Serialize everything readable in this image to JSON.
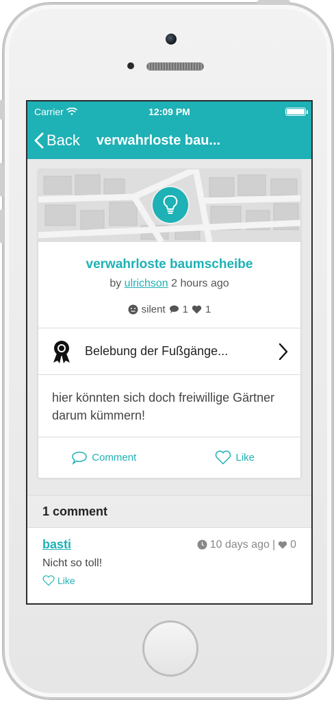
{
  "status": {
    "carrier": "Carrier",
    "time": "12:09 PM"
  },
  "nav": {
    "back_label": "Back",
    "title": "verwahrloste bau..."
  },
  "post": {
    "title": "verwahrloste baumscheibe",
    "by_prefix": "by",
    "author": "ulrichson",
    "age": "2 hours ago",
    "state": "silent",
    "comment_count": "1",
    "like_count": "1",
    "category": "Belebung der Fußgänge...",
    "body": "hier könnten sich doch freiwillige Gärtner darum kümmern!",
    "comment_action": "Comment",
    "like_action": "Like"
  },
  "comments_section": {
    "header": "1 comment",
    "items": [
      {
        "author": "basti",
        "age": "10 days ago",
        "likes": "0",
        "text": "Nicht so toll!",
        "like_label": "Like"
      }
    ]
  },
  "colors": {
    "accent": "#1eb1b5"
  }
}
